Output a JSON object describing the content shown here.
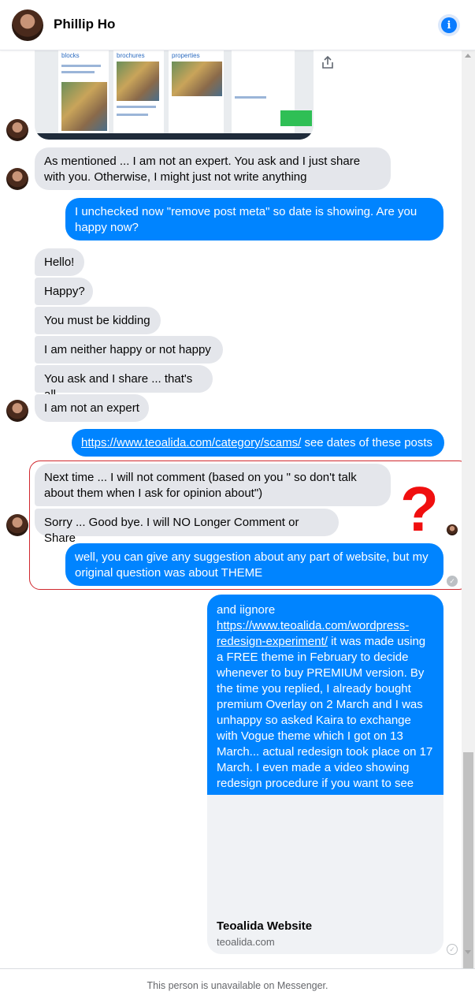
{
  "contact": {
    "name": "Phillip Ho"
  },
  "messages": {
    "m1": "As mentioned ... I am not an expert. You ask and I just share with you. Otherwise, I might just not write anything",
    "m2": "I unchecked now \"remove post meta\" so date is showing. Are you happy now?",
    "m3": "Hello!",
    "m4": "Happy?",
    "m5": "You must be kidding",
    "m6": "I am neither happy or not happy",
    "m7": "You ask and I share ... that's all",
    "m8": "I am not an expert",
    "m9_link": "https://www.teoalida.com/category/scams/",
    "m9_rest": " see dates of these posts",
    "m10": "Next time ... I will not comment (based on you \" so don't talk about them when I ask for opinion about\")",
    "m11": "Sorry ... Good bye. I will NO Longer Comment or Share",
    "m12": "well, you can give any suggestion about any part of website, but my original question was about THEME",
    "m13_pre": "and iignore ",
    "m13_link": "https://www.teoalida.com/wordpress-redesign-experiment/",
    "m13_rest": " it was made using a FREE theme in February to decide whenever to buy PREMIUM version. By the time you replied, I already bought premium Overlay on 2 March and I was unhappy so asked Kaira to exchange with Vogue theme which I got on 13 March... actual redesign took place on 17 March. I even made a video showing redesign procedure if you want to see"
  },
  "link_preview": {
    "title": "Teoalida Website",
    "domain": "teoalida.com"
  },
  "annotation": {
    "mark": "?"
  },
  "shot_labels": {
    "c1": "blocks",
    "c2": "brochures",
    "c3": "properties"
  },
  "footer": {
    "notice": "This person is unavailable on Messenger."
  },
  "colors": {
    "outgoing": "#0084ff",
    "incoming": "#e4e6eb",
    "highlight": "#d0282e",
    "question": "#f00f0f"
  },
  "icons": {
    "info": "info-icon",
    "share": "share-icon",
    "seen": "check-icon"
  }
}
